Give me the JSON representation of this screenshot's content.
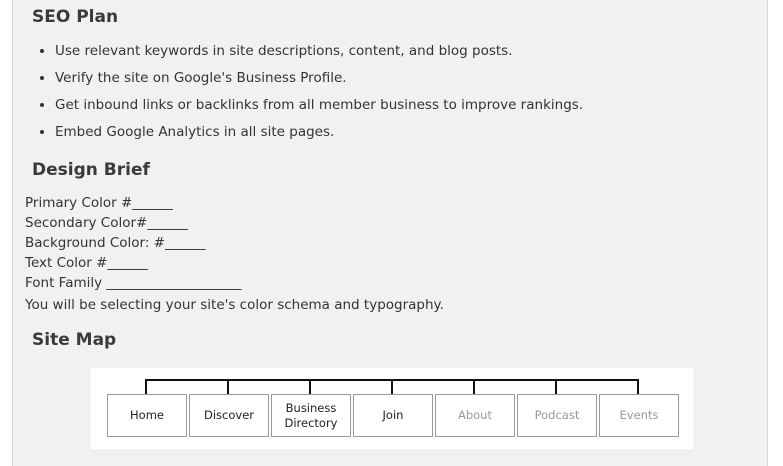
{
  "seo": {
    "title": "SEO Plan",
    "items": [
      "Use relevant keywords in site descriptions, content, and blog posts.",
      "Verify the site on Google's Business Profile.",
      "Get inbound links or backlinks from all member business to improve rankings.",
      "Embed Google Analytics in all site pages."
    ]
  },
  "design": {
    "title": "Design Brief",
    "fields": [
      "Primary Color #______",
      "Secondary Color#______",
      "Background Color: #______",
      "Text Color #______",
      "Font Family ____________________"
    ],
    "note": "You will be selecting your site's color schema and typography."
  },
  "sitemap": {
    "title": "Site Map",
    "pages": [
      {
        "label": "Home",
        "state": "active"
      },
      {
        "label": "Discover",
        "state": "active"
      },
      {
        "label": "Business Directory",
        "state": "active"
      },
      {
        "label": "Join",
        "state": "active"
      },
      {
        "label": "About",
        "state": "muted"
      },
      {
        "label": "Podcast",
        "state": "muted"
      },
      {
        "label": "Events",
        "state": "muted"
      }
    ]
  }
}
